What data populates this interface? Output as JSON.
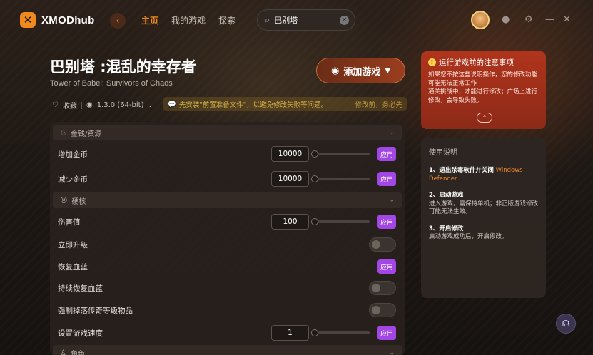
{
  "app": {
    "name": "XMODhub"
  },
  "nav": {
    "items": [
      "主页",
      "我的游戏",
      "探索"
    ]
  },
  "search": {
    "value": "巴别塔"
  },
  "game": {
    "title": "巴别塔 :混乱的幸存者",
    "subtitle": "Tower of Babel: Survivors of Chaos",
    "add_label": "添加游戏",
    "favorite_label": "收藏",
    "version": "1.3.0 (64-bit)",
    "notice_text": "先安装\"前置准备文件\"，以避免修改失败等问题。",
    "notice_right": "修改前，务必先"
  },
  "sections": [
    {
      "label": "金钱/资源",
      "rows": [
        {
          "label": "增加金币",
          "value": "10000",
          "apply": "应用"
        },
        {
          "label": "减少金币",
          "value": "10000",
          "apply": "应用"
        }
      ]
    },
    {
      "label": "硬核",
      "rows": [
        {
          "label": "伤害值",
          "value": "100",
          "apply": "应用"
        },
        {
          "label": "立即升级"
        },
        {
          "label": "恢复血蓝",
          "apply": "应用"
        },
        {
          "label": "持续恢复血蓝"
        },
        {
          "label": "强制掉落传奇等级物品"
        },
        {
          "label": "设置游戏速度",
          "value": "1",
          "apply": "应用"
        }
      ]
    },
    {
      "label": "角色"
    }
  ],
  "warning": {
    "title": "运行游戏前的注意事项",
    "body": "如果您不按这些说明操作，您的修改功能可能无法正常工作\n通关挑战中，才能进行修改；广场上进行修改，会导致失败。"
  },
  "guide": {
    "title": "使用说明",
    "steps": [
      {
        "title": "1、退出杀毒软件并关闭",
        "highlight": "Windows Defender",
        "desc": ""
      },
      {
        "title": "2、启动游戏",
        "highlight": "",
        "desc": "进入游戏，需保持单机；非正版游戏修改可能无法生效。"
      },
      {
        "title": "3、开启修改",
        "highlight": "",
        "desc": "启动游戏成功后，开启修改。"
      }
    ]
  },
  "colors": {
    "accent": "#f08a1c",
    "apply": "#a247e6",
    "warning": "#b0341c"
  }
}
